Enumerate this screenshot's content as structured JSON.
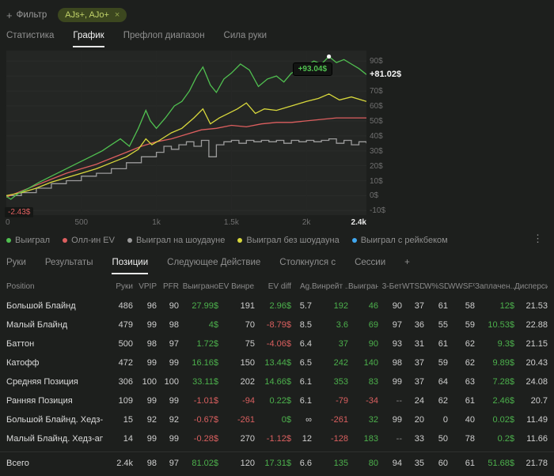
{
  "colors": {
    "positive": "#4cb04c",
    "negative": "#d95f5f",
    "tag_bg": "#3c471f",
    "tag_text": "#c2d46a"
  },
  "topbar": {
    "filter_label": "Фильтр",
    "filter_tag": "AJs+, AJo+"
  },
  "main_tabs": [
    {
      "label": "Статистика",
      "active": false
    },
    {
      "label": "График",
      "active": true
    },
    {
      "label": "Префлоп диапазон",
      "active": false
    },
    {
      "label": "Сила руки",
      "active": false
    }
  ],
  "chart_data": {
    "type": "line",
    "xlim": [
      0,
      2400
    ],
    "ylim": [
      -13,
      97
    ],
    "xlabel": "",
    "ylabel": "",
    "grid": true,
    "legend_position": "bottom",
    "y_ticks": [
      {
        "v": 90,
        "label": "90$"
      },
      {
        "v": 80,
        "label": "80$"
      },
      {
        "v": 70,
        "label": "70$"
      },
      {
        "v": 60,
        "label": "60$"
      },
      {
        "v": 50,
        "label": "50$"
      },
      {
        "v": 40,
        "label": "40$"
      },
      {
        "v": 30,
        "label": "30$"
      },
      {
        "v": 20,
        "label": "20$"
      },
      {
        "v": 10,
        "label": "10$"
      },
      {
        "v": 0,
        "label": "0$"
      },
      {
        "v": -10,
        "label": "-10$"
      }
    ],
    "x_ticks": [
      {
        "v": 0,
        "label": "0"
      },
      {
        "v": 500,
        "label": "500"
      },
      {
        "v": 1000,
        "label": "1k"
      },
      {
        "v": 1500,
        "label": "1.5k"
      },
      {
        "v": 2000,
        "label": "2k"
      }
    ],
    "x_end_tick": {
      "v": 2400,
      "label": "2.4k"
    },
    "marker": {
      "x": 2150,
      "y": 93.04,
      "label": "+93.04$"
    },
    "end_label": {
      "v": 81.02,
      "label": "+81.02$"
    },
    "min_label": {
      "label": "-2.43$"
    },
    "series": [
      {
        "name": "Выиграл",
        "color": "#50c050",
        "points": [
          [
            0,
            -0.5
          ],
          [
            30,
            -2.43
          ],
          [
            80,
            1.5
          ],
          [
            150,
            5
          ],
          [
            220,
            9
          ],
          [
            300,
            13
          ],
          [
            380,
            17
          ],
          [
            480,
            22
          ],
          [
            560,
            26
          ],
          [
            640,
            30
          ],
          [
            700,
            34
          ],
          [
            760,
            38
          ],
          [
            820,
            33
          ],
          [
            880,
            45
          ],
          [
            930,
            57
          ],
          [
            960,
            50
          ],
          [
            1000,
            45
          ],
          [
            1060,
            52
          ],
          [
            1120,
            60
          ],
          [
            1170,
            63
          ],
          [
            1220,
            70
          ],
          [
            1270,
            80
          ],
          [
            1310,
            86
          ],
          [
            1360,
            74
          ],
          [
            1400,
            69
          ],
          [
            1450,
            78
          ],
          [
            1500,
            82
          ],
          [
            1560,
            88
          ],
          [
            1620,
            84
          ],
          [
            1680,
            73
          ],
          [
            1740,
            78
          ],
          [
            1800,
            80
          ],
          [
            1850,
            76
          ],
          [
            1900,
            82
          ],
          [
            1950,
            84
          ],
          [
            2000,
            87
          ],
          [
            2050,
            90
          ],
          [
            2100,
            88
          ],
          [
            2150,
            93.04
          ],
          [
            2200,
            89
          ],
          [
            2250,
            91
          ],
          [
            2300,
            88
          ],
          [
            2350,
            85
          ],
          [
            2400,
            81.02
          ]
        ]
      },
      {
        "name": "Олл-ин EV",
        "color": "#dd5f5f",
        "points": [
          [
            0,
            -1
          ],
          [
            100,
            3
          ],
          [
            200,
            7
          ],
          [
            300,
            11
          ],
          [
            400,
            15
          ],
          [
            500,
            18
          ],
          [
            600,
            21
          ],
          [
            700,
            25
          ],
          [
            800,
            29
          ],
          [
            900,
            33
          ],
          [
            1000,
            36
          ],
          [
            1100,
            38
          ],
          [
            1200,
            41
          ],
          [
            1300,
            44
          ],
          [
            1400,
            45
          ],
          [
            1500,
            47
          ],
          [
            1600,
            46
          ],
          [
            1700,
            48
          ],
          [
            1800,
            49
          ],
          [
            1900,
            49
          ],
          [
            2000,
            50
          ],
          [
            2100,
            51
          ],
          [
            2200,
            52
          ],
          [
            2300,
            52
          ],
          [
            2400,
            52
          ]
        ]
      },
      {
        "name": "Выиграл на шоудауне",
        "color": "#9b9b9b",
        "step": true,
        "points": [
          [
            0,
            0
          ],
          [
            100,
            2
          ],
          [
            200,
            5
          ],
          [
            300,
            8
          ],
          [
            400,
            10
          ],
          [
            500,
            13
          ],
          [
            600,
            15
          ],
          [
            700,
            18
          ],
          [
            800,
            22
          ],
          [
            900,
            26
          ],
          [
            1000,
            29
          ],
          [
            1050,
            33
          ],
          [
            1100,
            31
          ],
          [
            1150,
            34
          ],
          [
            1200,
            36
          ],
          [
            1250,
            33
          ],
          [
            1300,
            37
          ],
          [
            1350,
            26
          ],
          [
            1400,
            34
          ],
          [
            1450,
            36
          ],
          [
            1500,
            37
          ],
          [
            1550,
            35
          ],
          [
            1600,
            37
          ],
          [
            1650,
            36
          ],
          [
            1700,
            37
          ],
          [
            1750,
            36
          ],
          [
            1800,
            37
          ],
          [
            1850,
            35
          ],
          [
            1900,
            37
          ],
          [
            1950,
            36
          ],
          [
            2000,
            37
          ],
          [
            2050,
            36
          ],
          [
            2100,
            37
          ],
          [
            2150,
            38
          ],
          [
            2200,
            35
          ],
          [
            2250,
            37
          ],
          [
            2300,
            34
          ],
          [
            2350,
            36
          ],
          [
            2400,
            35
          ]
        ]
      },
      {
        "name": "Выиграл без шоудауна",
        "color": "#d8d83c",
        "points": [
          [
            0,
            0
          ],
          [
            100,
            2
          ],
          [
            200,
            5
          ],
          [
            300,
            9
          ],
          [
            400,
            12
          ],
          [
            500,
            15
          ],
          [
            600,
            18
          ],
          [
            700,
            22
          ],
          [
            800,
            26
          ],
          [
            880,
            31
          ],
          [
            930,
            38
          ],
          [
            970,
            34
          ],
          [
            1020,
            37
          ],
          [
            1100,
            42
          ],
          [
            1170,
            45
          ],
          [
            1250,
            52
          ],
          [
            1310,
            58
          ],
          [
            1360,
            48
          ],
          [
            1420,
            52
          ],
          [
            1480,
            55
          ],
          [
            1540,
            58
          ],
          [
            1600,
            62
          ],
          [
            1660,
            55
          ],
          [
            1720,
            58
          ],
          [
            1800,
            57
          ],
          [
            1900,
            60
          ],
          [
            2000,
            63
          ],
          [
            2080,
            65
          ],
          [
            2150,
            68
          ],
          [
            2220,
            64
          ],
          [
            2300,
            66
          ],
          [
            2400,
            63
          ]
        ]
      },
      {
        "name": "Выиграл с рейкбеком",
        "color": "#41a8f0",
        "points": []
      }
    ]
  },
  "table_tabs": [
    {
      "label": "Руки",
      "active": false
    },
    {
      "label": "Результаты",
      "active": false
    },
    {
      "label": "Позиции",
      "active": true
    },
    {
      "label": "Следующее Действие",
      "active": false
    },
    {
      "label": "Столкнулся с",
      "active": false
    },
    {
      "label": "Сессии",
      "active": false
    },
    {
      "label": "+",
      "active": false
    }
  ],
  "table": {
    "columns": [
      {
        "label": "Position",
        "rule": "text"
      },
      {
        "label": "Руки",
        "rule": "plain"
      },
      {
        "label": "VPIP",
        "rule": "plain"
      },
      {
        "label": "PFR",
        "rule": "plain"
      },
      {
        "label": "Выиграно",
        "rule": "sign"
      },
      {
        "label": "EV Винре...",
        "rule": "neg_red"
      },
      {
        "label": "EV diff",
        "rule": "sign"
      },
      {
        "label": "Ag.",
        "rule": "plain"
      },
      {
        "label": "Винрейт ...",
        "rule": "sign"
      },
      {
        "label": "Выиграно...",
        "rule": "sign"
      },
      {
        "label": "3-Бет",
        "rule": "plain"
      },
      {
        "label": "WTSD",
        "rule": "plain"
      },
      {
        "label": "W%SD",
        "rule": "plain"
      },
      {
        "label": "WWSF%",
        "rule": "plain"
      },
      {
        "label": "Заплачен...",
        "rule": "sign"
      },
      {
        "label": "Дисперси...",
        "rule": "plain"
      }
    ],
    "rows": [
      [
        "Большой Блайнд",
        "486",
        "96",
        "90",
        "27.99$",
        "191",
        "2.96$",
        "5.7",
        "192",
        "46",
        "90",
        "37",
        "61",
        "58",
        "12$",
        "21.53"
      ],
      [
        "Малый Блайнд",
        "479",
        "99",
        "98",
        "4$",
        "70",
        "-8.79$",
        "8.5",
        "3.6",
        "69",
        "97",
        "36",
        "55",
        "59",
        "10.53$",
        "22.88"
      ],
      [
        "Баттон",
        "500",
        "98",
        "97",
        "1.72$",
        "75",
        "-4.06$",
        "6.4",
        "37",
        "90",
        "93",
        "31",
        "61",
        "62",
        "9.3$",
        "21.15"
      ],
      [
        "Катофф",
        "472",
        "99",
        "99",
        "16.16$",
        "150",
        "13.44$",
        "6.5",
        "242",
        "140",
        "98",
        "37",
        "59",
        "62",
        "9.89$",
        "20.43"
      ],
      [
        "Средняя Позиция",
        "306",
        "100",
        "100",
        "33.11$",
        "202",
        "14.66$",
        "6.1",
        "353",
        "83",
        "99",
        "37",
        "64",
        "63",
        "7.28$",
        "24.08"
      ],
      [
        "Ранняя Позиция",
        "109",
        "99",
        "99",
        "-1.01$",
        "-94",
        "0.22$",
        "6.1",
        "-79",
        "-34",
        "--",
        "24",
        "62",
        "61",
        "2.46$",
        "20.7"
      ],
      [
        "Большой Блайнд. Хедз-ап",
        "15",
        "92",
        "92",
        "-0.67$",
        "-261",
        "0$",
        "∞",
        "-261",
        "32",
        "99",
        "20",
        "0",
        "40",
        "0.02$",
        "11.49"
      ],
      [
        "Малый Блайнд. Хедз-ап",
        "14",
        "99",
        "99",
        "-0.28$",
        "270",
        "-1.12$",
        "12",
        "-128",
        "183",
        "--",
        "33",
        "50",
        "78",
        "0.2$",
        "11.66"
      ]
    ],
    "total": [
      "Всего",
      "2.4k",
      "98",
      "97",
      "81.02$",
      "120",
      "17.31$",
      "6.6",
      "135",
      "80",
      "94",
      "35",
      "60",
      "61",
      "51.68$",
      "21.78"
    ]
  }
}
